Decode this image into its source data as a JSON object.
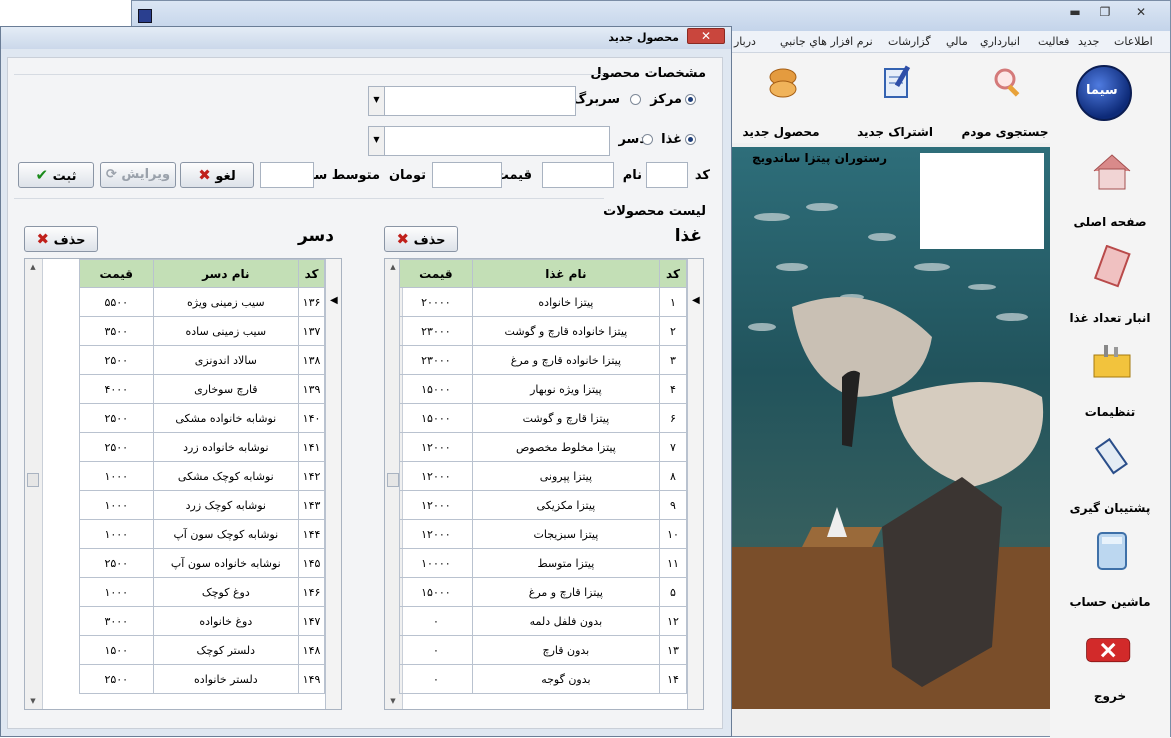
{
  "main": {
    "window_controls": [
      "▬",
      "❐",
      "✕"
    ],
    "menu": [
      "اطلاعات",
      "جدید",
      "فعالیت",
      "انبارداري",
      "مالي",
      "گزارشات",
      "نرم افزار هاي جانبي",
      "دربار"
    ],
    "toolbar": [
      {
        "label": "جستجوی مودم",
        "icon": "magnifier-icon"
      },
      {
        "label": "اشتراک جدید",
        "icon": "notepad-pen-icon"
      },
      {
        "label": "محصول جدید",
        "icon": "bread-icon"
      }
    ],
    "logo_text": "سیما",
    "sidebar": [
      {
        "label": "صفحه اصلی",
        "icon": "house-icon"
      },
      {
        "label": "انبار تعداد غذا",
        "icon": "ledger-icon"
      },
      {
        "label": "تنظیمات",
        "icon": "toolbox-icon"
      },
      {
        "label": "پشتیبان گیری",
        "icon": "usb-drive-icon"
      },
      {
        "label": "ماشین حساب",
        "icon": "calculator-icon"
      },
      {
        "label": "خروج",
        "icon": "exit-x-icon"
      }
    ],
    "photo_caption": "رستوران پیتزا ساندویچ"
  },
  "dialog": {
    "title": "محصول جدید",
    "close": "✕",
    "section_spec": "مشخصات محصول",
    "radio_center": "مرکز",
    "radio_branch": "سربرگ",
    "radio_food": "غذا",
    "radio_dessert": "دسر",
    "label_code": "کد",
    "label_name": "نام",
    "label_price": "قیمت",
    "label_toman": "تومان",
    "label_avg_profit": "متوسط سود",
    "btn_cancel": "لغو",
    "btn_edit": "ویرایش",
    "btn_submit": "ثبت",
    "section_list": "لیست محصولات",
    "food_heading": "غذا",
    "dessert_heading": "دسر",
    "btn_delete": "حذف",
    "food_table": {
      "headers": [
        "کد",
        "نام غذا",
        "قیمت"
      ],
      "rows": [
        [
          "۱",
          "پیتزا خانواده",
          "۲۰۰۰۰"
        ],
        [
          "۲",
          "پیتزا خانواده قارچ و گوشت",
          "۲۳۰۰۰"
        ],
        [
          "۳",
          "پیتزا خانواده قارچ و مرغ",
          "۲۳۰۰۰"
        ],
        [
          "۴",
          "پیتزا ویژه نوبهار",
          "۱۵۰۰۰"
        ],
        [
          "۶",
          "پیتزا قارچ و گوشت",
          "۱۵۰۰۰"
        ],
        [
          "۷",
          "پیتزا مخلوط مخصوص",
          "۱۲۰۰۰"
        ],
        [
          "۸",
          "پیتزا پپرونی",
          "۱۲۰۰۰"
        ],
        [
          "۹",
          "پیتزا مکزیکی",
          "۱۲۰۰۰"
        ],
        [
          "۱۰",
          "پیتزا سبزیجات",
          "۱۲۰۰۰"
        ],
        [
          "۱۱",
          "پیتزا متوسط",
          "۱۰۰۰۰"
        ],
        [
          "۵",
          "پیتزا قارچ و مرغ",
          "۱۵۰۰۰"
        ],
        [
          "۱۲",
          "بدون فلفل دلمه",
          "۰"
        ],
        [
          "۱۳",
          "بدون قارچ",
          "۰"
        ],
        [
          "۱۴",
          "بدون گوجه",
          "۰"
        ]
      ]
    },
    "dessert_table": {
      "headers": [
        "کد",
        "نام دسر",
        "قیمت"
      ],
      "rows": [
        [
          "۱۳۶",
          "سیب زمینی ویژه",
          "۵۵۰۰"
        ],
        [
          "۱۳۷",
          "سیب زمینی ساده",
          "۳۵۰۰"
        ],
        [
          "۱۳۸",
          "سالاد اندونزی",
          "۲۵۰۰"
        ],
        [
          "۱۳۹",
          "قارچ سوخاری",
          "۴۰۰۰"
        ],
        [
          "۱۴۰",
          "نوشابه خانواده مشکی",
          "۲۵۰۰"
        ],
        [
          "۱۴۱",
          "نوشابه خانواده زرد",
          "۲۵۰۰"
        ],
        [
          "۱۴۲",
          "نوشابه کوچک مشکی",
          "۱۰۰۰"
        ],
        [
          "۱۴۳",
          "نوشابه کوچک زرد",
          "۱۰۰۰"
        ],
        [
          "۱۴۴",
          "نوشابه کوچک سون آپ",
          "۱۰۰۰"
        ],
        [
          "۱۴۵",
          "نوشابه خانواده سون آپ",
          "۲۵۰۰"
        ],
        [
          "۱۴۶",
          "دوغ کوچک",
          "۱۰۰۰"
        ],
        [
          "۱۴۷",
          "دوغ خانواده",
          "۳۰۰۰"
        ],
        [
          "۱۴۸",
          "دلستر کوچک",
          "۱۵۰۰"
        ],
        [
          "۱۴۹",
          "دلستر خانواده",
          "۲۵۰۰"
        ]
      ]
    }
  },
  "colors": {
    "header_green": "#c3dfb6",
    "accent_red": "#c0201b",
    "title_blue": "#dbe6f4"
  }
}
